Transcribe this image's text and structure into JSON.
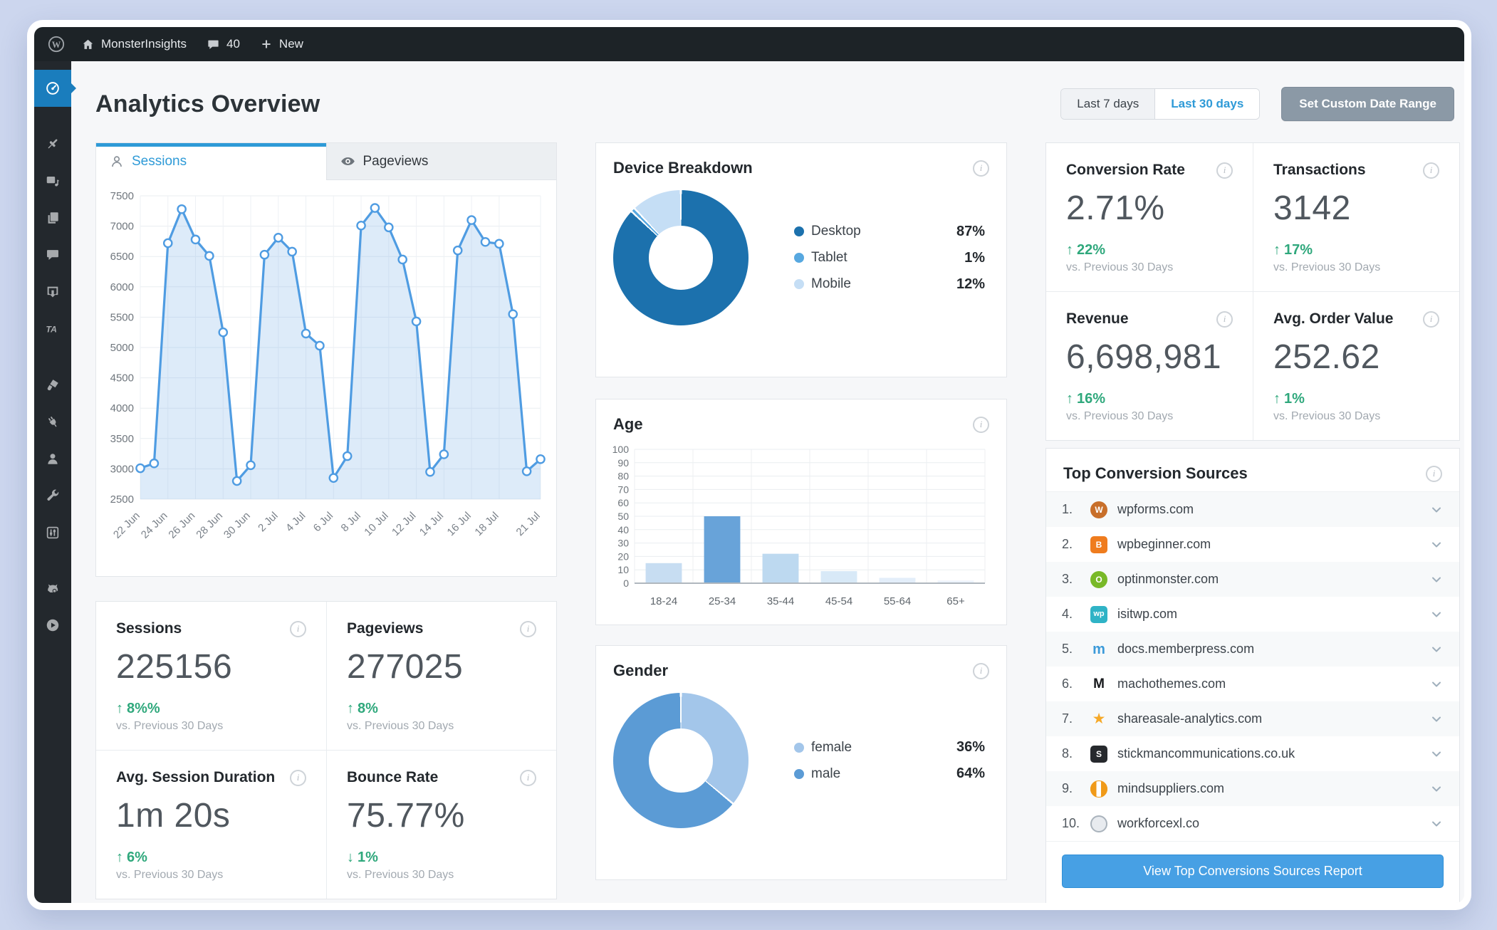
{
  "admin_bar": {
    "site_name": "MonsterInsights",
    "comments_count": "40",
    "new_label": "New"
  },
  "sidebar": {
    "items": [
      "dashboard",
      "posts",
      "media",
      "pages",
      "comments",
      "downloads",
      "ta-analytics",
      "appearance",
      "plugins",
      "users",
      "tools",
      "settings",
      "seo",
      "video"
    ],
    "active_item": "dashboard"
  },
  "page": {
    "title": "Analytics Overview"
  },
  "date_controls": {
    "last7_label": "Last 7 days",
    "last30_label": "Last 30 days",
    "selected": "Last 30 days",
    "custom_label": "Set Custom Date Range"
  },
  "tabs": {
    "sessions": "Sessions",
    "pageviews": "Pageviews"
  },
  "stats": {
    "sessions": {
      "label": "Sessions",
      "value": "225156",
      "arrow": "↑",
      "change": "8%%",
      "compare": "vs. Previous 30 Days"
    },
    "pageviews": {
      "label": "Pageviews",
      "value": "277025",
      "arrow": "↑",
      "change": "8%",
      "compare": "vs. Previous 30 Days"
    },
    "avg_duration": {
      "label": "Avg. Session Duration",
      "value": "1m 20s",
      "arrow": "↑",
      "change": "6%",
      "compare": "vs. Previous 30 Days"
    },
    "bounce_rate": {
      "label": "Bounce Rate",
      "value": "75.77%",
      "arrow": "↓",
      "change": "1%",
      "compare": "vs. Previous 30 Days"
    },
    "conversion_rate": {
      "label": "Conversion Rate",
      "value": "2.71%",
      "arrow": "↑",
      "change": "22%",
      "compare": "vs. Previous 30 Days"
    },
    "transactions": {
      "label": "Transactions",
      "value": "3142",
      "arrow": "↑",
      "change": "17%",
      "compare": "vs. Previous 30 Days"
    },
    "revenue": {
      "label": "Revenue",
      "value": "6,698,981",
      "arrow": "↑",
      "change": "16%",
      "compare": "vs. Previous 30 Days"
    },
    "avg_order_value": {
      "label": "Avg. Order Value",
      "value": "252.62",
      "arrow": "↑",
      "change": "1%",
      "compare": "vs. Previous 30 Days"
    }
  },
  "sources": {
    "title": "Top Conversion Sources",
    "button": "View Top Conversions Sources Report",
    "items": [
      {
        "rank": "1.",
        "domain": "wpforms.com",
        "icon": {
          "kind": "letter",
          "bg": "#c86f2a",
          "fg": "#ffffff",
          "text": "W",
          "radius": "50%",
          "size": "12px"
        }
      },
      {
        "rank": "2.",
        "domain": "wpbeginner.com",
        "icon": {
          "kind": "letter",
          "bg": "#ef7c1e",
          "fg": "#ffffff",
          "text": "B",
          "radius": "5px",
          "size": "12px"
        }
      },
      {
        "rank": "3.",
        "domain": "optinmonster.com",
        "icon": {
          "kind": "letter",
          "bg": "#79b928",
          "fg": "#ffffff",
          "text": "O",
          "radius": "50%",
          "size": "12px"
        }
      },
      {
        "rank": "4.",
        "domain": "isitwp.com",
        "icon": {
          "kind": "letter",
          "bg": "#2fb3c6",
          "fg": "#ffffff",
          "text": "wp",
          "radius": "5px",
          "size": "11px"
        }
      },
      {
        "rank": "5.",
        "domain": "docs.memberpress.com",
        "icon": {
          "kind": "letter",
          "bg": "transparent",
          "fg": "#3b9ad9",
          "text": "m",
          "radius": "0",
          "size": "20px"
        }
      },
      {
        "rank": "6.",
        "domain": "machothemes.com",
        "icon": {
          "kind": "letter",
          "bg": "transparent",
          "fg": "#16181b",
          "text": "M",
          "radius": "0",
          "size": "19px"
        }
      },
      {
        "rank": "7.",
        "domain": "shareasale-analytics.com",
        "icon": {
          "kind": "star",
          "fg": "#f6a928"
        }
      },
      {
        "rank": "8.",
        "domain": "stickmancommunications.co.uk",
        "icon": {
          "kind": "letter",
          "bg": "#26292d",
          "fg": "#ffffff",
          "text": "S",
          "radius": "5px",
          "size": "12px"
        }
      },
      {
        "rank": "9.",
        "domain": "mindsuppliers.com",
        "icon": {
          "kind": "split",
          "bg": "#f09a18"
        }
      },
      {
        "rank": "10.",
        "domain": "workforcexl.co",
        "icon": {
          "kind": "globe",
          "bg": "#e8ebef",
          "fg": "#aab3bc"
        }
      }
    ]
  },
  "chart_data": [
    {
      "name": "sessions_over_time",
      "type": "line",
      "title": "Sessions",
      "values": [
        3010,
        3090,
        6720,
        7280,
        6780,
        6510,
        5250,
        2800,
        3060,
        6530,
        6810,
        6580,
        5230,
        5030,
        2850,
        3210,
        7010,
        7300,
        6980,
        6450,
        5430,
        2950,
        3240,
        6600,
        7100,
        6740,
        6710,
        5550,
        2960,
        3160
      ],
      "x_tick_labels": [
        "22 Jun",
        "24 Jun",
        "26 Jun",
        "28 Jun",
        "30 Jun",
        "2 Jul",
        "4 Jul",
        "6 Jul",
        "8 Jul",
        "10 Jul",
        "12 Jul",
        "14 Jul",
        "16 Jul",
        "18 Jul",
        "21 Jul"
      ],
      "x_tick_indices": [
        0,
        2,
        4,
        6,
        8,
        10,
        12,
        14,
        16,
        18,
        20,
        22,
        24,
        26,
        29
      ],
      "ylim": [
        2500,
        7500
      ],
      "ystep": 500,
      "grid": true,
      "line_color": "#4f9ce2",
      "fill_color": "rgba(120,176,230,0.25)",
      "marker": "circle"
    },
    {
      "name": "device_breakdown",
      "type": "donut",
      "title": "Device Breakdown",
      "labels": [
        "Desktop",
        "Tablet",
        "Mobile"
      ],
      "values": [
        87,
        1,
        12
      ],
      "colors": [
        "#1c71ad",
        "#57a8e0",
        "#c5def5"
      ],
      "legend": [
        {
          "label": "Desktop",
          "value": "87%"
        },
        {
          "label": "Tablet",
          "value": "1%"
        },
        {
          "label": "Mobile",
          "value": "12%"
        }
      ],
      "legend_position": "right"
    },
    {
      "name": "age",
      "type": "bar",
      "title": "Age",
      "categories": [
        "18-24",
        "25-34",
        "35-44",
        "45-54",
        "55-64",
        "65+"
      ],
      "values": [
        15,
        50,
        22,
        9,
        4,
        2
      ],
      "bar_colors": [
        "#c7ddf2",
        "#68a3d9",
        "#bdd9f0",
        "#d8e9f7",
        "#e3eefa",
        "#edf4fc"
      ],
      "ylim": [
        0,
        100
      ],
      "ystep": 10,
      "grid": true
    },
    {
      "name": "gender",
      "type": "donut",
      "title": "Gender",
      "labels": [
        "female",
        "male"
      ],
      "values": [
        36,
        64
      ],
      "colors": [
        "#a3c6ea",
        "#5b9bd5"
      ],
      "legend": [
        {
          "label": "female",
          "value": "36%"
        },
        {
          "label": "male",
          "value": "64%"
        }
      ],
      "legend_position": "right"
    }
  ],
  "colors": {
    "accent_blue": "#2e9ad7",
    "positive_green": "#2fa87c",
    "admin_bar": "#1d2327",
    "sidebar": "#23282d",
    "sidebar_active": "#1a7dbd",
    "report_button": "#47a0e4",
    "custom_range_button": "#8b99a6"
  }
}
